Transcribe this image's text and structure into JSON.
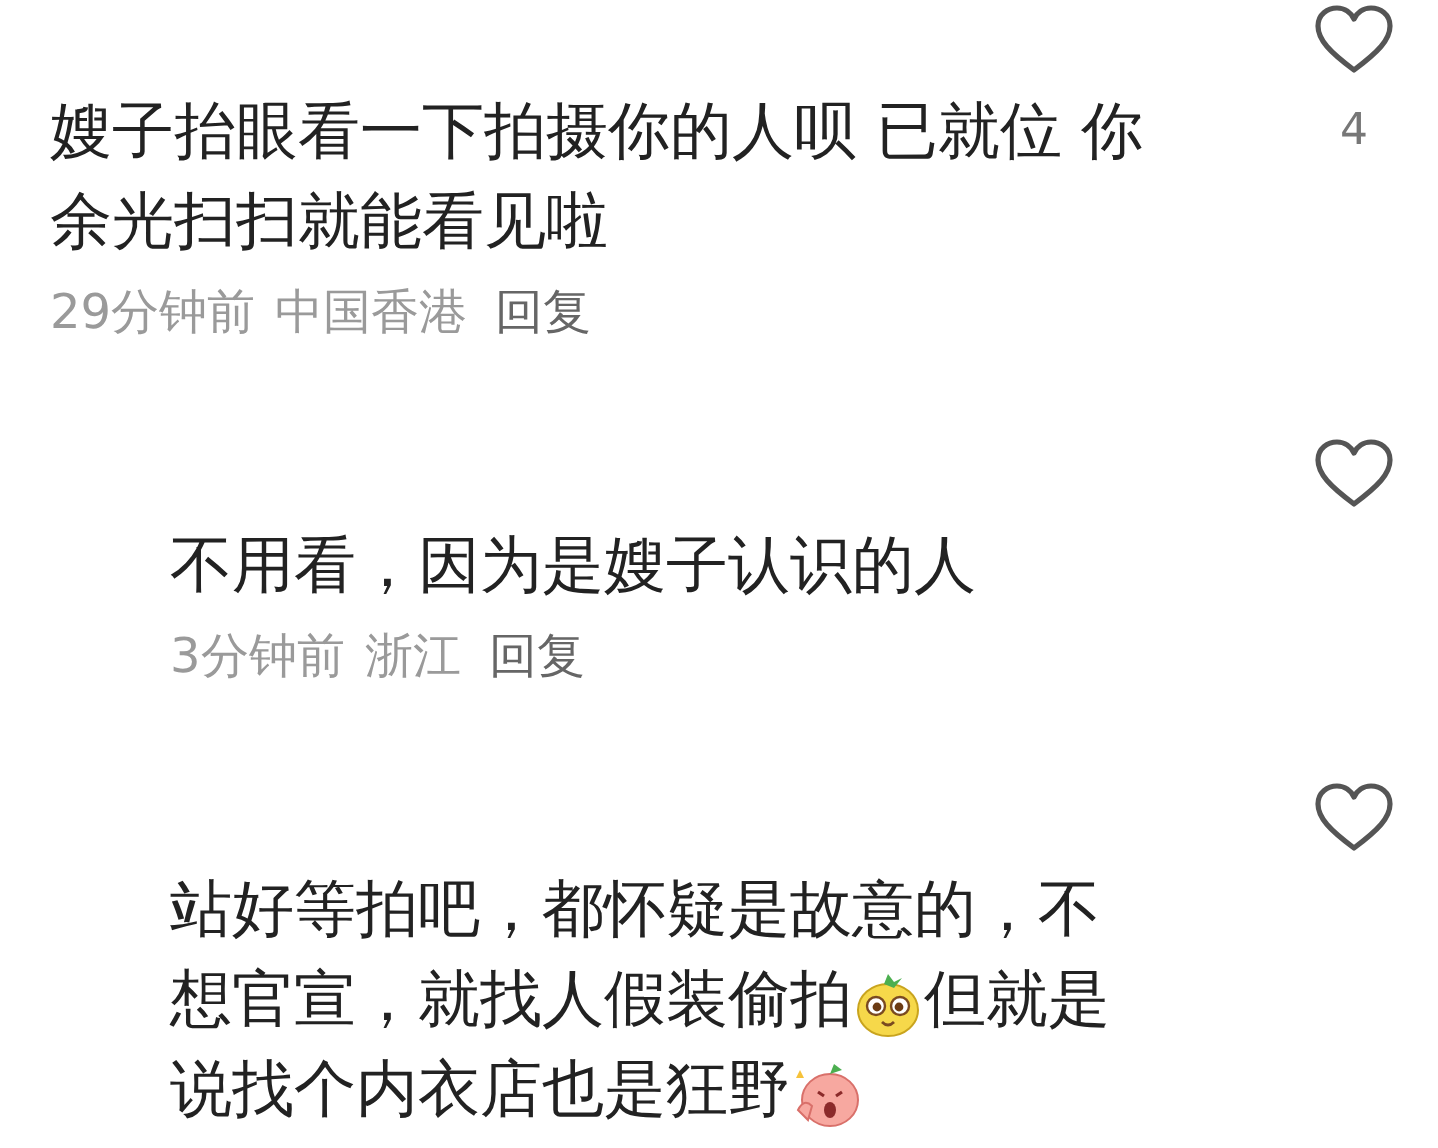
{
  "comments": [
    {
      "body": [
        {
          "kind": "text",
          "text": "嫂子抬眼看一下拍摄你的人呗 已就位 你余光扫扫就能看见啦"
        }
      ],
      "time": "29分钟前",
      "location": "中国香港",
      "reply": "回复",
      "likes": "4",
      "children": [
        {
          "body": [
            {
              "kind": "text",
              "text": "不用看，因为是嫂子认识的人"
            }
          ],
          "time": "3分钟前",
          "location": "浙江",
          "reply": "回复"
        },
        {
          "body": [
            {
              "kind": "text",
              "text": "站好等拍吧，都怀疑是故意的，不想官宣，就找人假装偷拍"
            },
            {
              "kind": "sprout-face"
            },
            {
              "kind": "text",
              "text": "但就是说找个内衣店也是狂野"
            },
            {
              "kind": "blush-face"
            }
          ]
        }
      ]
    }
  ]
}
